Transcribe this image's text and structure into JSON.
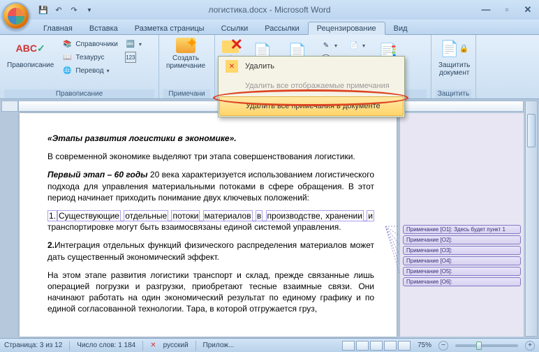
{
  "titlebar": {
    "title": "логистика.docx - Microsoft Word"
  },
  "tabs": {
    "items": [
      "Главная",
      "Вставка",
      "Разметка страницы",
      "Ссылки",
      "Рассылки",
      "Рецензирование",
      "Вид"
    ],
    "active_index": 5
  },
  "ribbon": {
    "group_spelling": {
      "main": "Правописание",
      "ref": "Справочники",
      "thes": "Тезаурус",
      "trans": "Перевод",
      "label": "Правописание"
    },
    "group_comments": {
      "new": "Создать\nпримечание",
      "label": "Примечани"
    },
    "group_protect": {
      "protect": "Защитить\nдокумент",
      "label": "Защитить"
    }
  },
  "dropdown": {
    "delete": "Удалить",
    "delete_shown": "Удалить все отображаемые примечания",
    "delete_all": "Удалить все примечания в документе"
  },
  "document": {
    "heading": "«Этапы развития логистики в экономике».",
    "p1": "В современной экономике выделяют три этапа совершенствования логистики.",
    "p2a": "Первый этап – 60 годы",
    "p2b": " 20 века характеризуется использованием логистического подхода для управления материальными потоками в сфере обращения. В этот период начинает приходить понимание двух ключевых положений:",
    "li1_num": "1.",
    "li1_w1": "Существующие",
    "li1_w2": "отдельные",
    "li1_w3": "потоки",
    "li1_w4": "материалов",
    "li1_w5": "в",
    "li1_w6": "производстве, хранении",
    "li1_w7": "и",
    "li1_tail": " транспортировке могут быть взаимосвязаны единой системой управления.",
    "li2": "2.Интеграция отдельных функций физического распределения материалов может дать существенный экономический эффект.",
    "p3": "На этом этапе развития логистики транспорт и склад, прежде связанные лишь операцией погрузки и разгрузки, приобретают тесные взаимные связи. Они начинают работать на один экономический результат по единому графику и по единой согласованной технологии. Тара, в которой отгружается груз,"
  },
  "comments": {
    "c1": "Примечание [O1]: Здесь будет пункт 1",
    "c2": "Примечание [O2]:",
    "c3": "Примечание [O3]:",
    "c4": "Примечание [O4]:",
    "c5": "Примечание [O5]:",
    "c6": "Примечание [O6]:"
  },
  "statusbar": {
    "page": "Страница: 3 из 12",
    "words": "Число слов: 1 184",
    "lang": "русский",
    "attach": "Прилож...",
    "zoom": "75%"
  }
}
